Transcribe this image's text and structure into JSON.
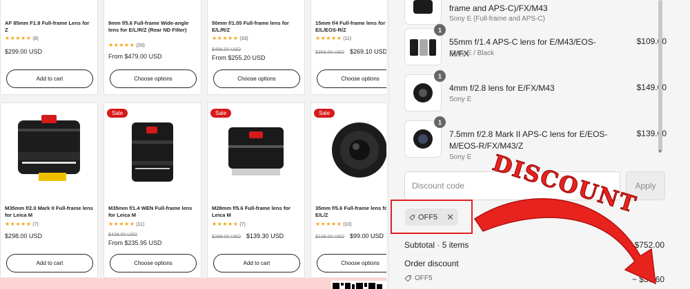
{
  "products": [
    {
      "title": "AF 85mm F1.8 Full-frame Lens for Z",
      "stars": "★★★★★",
      "reviews": "(8)",
      "price": "$299.00 USD",
      "button": "Add to cart"
    },
    {
      "title": "9mm f/5.6 Full-frame Wide-angle lens for E/L/R/Z (Rear ND Filter)",
      "stars": "★★★★★",
      "reviews": "(20)",
      "price": "From $479.00 USD",
      "button": "Choose options"
    },
    {
      "title": "50mm f/1.05 Full-frame lens for E/L/R/Z",
      "stars": "★★★★★",
      "reviews": "(33)",
      "old_price": "$486.00 USD",
      "price": "From $255.20 USD",
      "button": "Choose options"
    },
    {
      "title": "15mm f/4 Full-frame lens for E/L/EOS-R/Z",
      "stars": "★★★★★",
      "reviews": "(11)",
      "old_price": "$359.00 USD",
      "price": "$269.10 USD",
      "button": "Choose options"
    },
    {
      "title": "M35mm f/2.0 Mark II Full-frame lens for Leica M",
      "stars": "★★★★★",
      "reviews": "(7)",
      "price": "$298.00 USD",
      "button": "Add to cart"
    },
    {
      "sale": "Sale",
      "title": "M35mm f/1.4 WEN Full-frame lens for Leica M",
      "stars": "★★★★★",
      "reviews": "(11)",
      "old_price": "$429.00 USD",
      "price": "From $235.95 USD",
      "button": "Choose options"
    },
    {
      "sale": "Sale",
      "title": "M28mm f/5.6 Full-frame lens for Leica M",
      "stars": "★★★★★",
      "reviews": "(7)",
      "old_price": "$299.00 USD",
      "price": "$139.30 USD",
      "button": "Add to cart"
    },
    {
      "sale": "Sale",
      "title": "35mm f/5.6 Full-frame lens for E/L/Z",
      "stars": "★★★★★",
      "reviews": "(10)",
      "old_price": "$139.00 USD",
      "price": "$99.00 USD",
      "button": "Choose options"
    }
  ],
  "cart": {
    "partial_item": {
      "name": "frame and APS-C)/FX/M43",
      "variant": "Sony E (Full-frame and APS-C)"
    },
    "items": [
      {
        "qty": "1",
        "name": "55mm f/1.4 APS-C lens for E/M43/EOS-M/FX",
        "variant": "Sony E / Black",
        "price": "$109.00"
      },
      {
        "qty": "1",
        "name": "4mm f/2.8 lens for E/FX/M43",
        "variant": "Sony E",
        "price": "$149.00"
      },
      {
        "qty": "1",
        "name": "7.5mm f/2.8 Mark II APS-C lens for E/EOS-M/EOS-R/FX/M43/Z",
        "variant": "Sony E",
        "price": "$139.00"
      }
    ],
    "discount_placeholder": "Discount code",
    "apply_label": "Apply",
    "applied_code": "OFF5",
    "subtotal_label": "Subtotal · 5 items",
    "subtotal_value": "$752.00",
    "order_discount_label": "Order discount",
    "order_discount_code": "OFF5",
    "order_discount_value": "− $37.60"
  },
  "annotation": {
    "text": "DISCOUNT",
    "color": "#e8231d"
  },
  "colors": {
    "sale_badge": "#d6191b",
    "star": "#f2a51a",
    "highlight": "#e02020",
    "promo_bg": "#fcd5d2"
  }
}
